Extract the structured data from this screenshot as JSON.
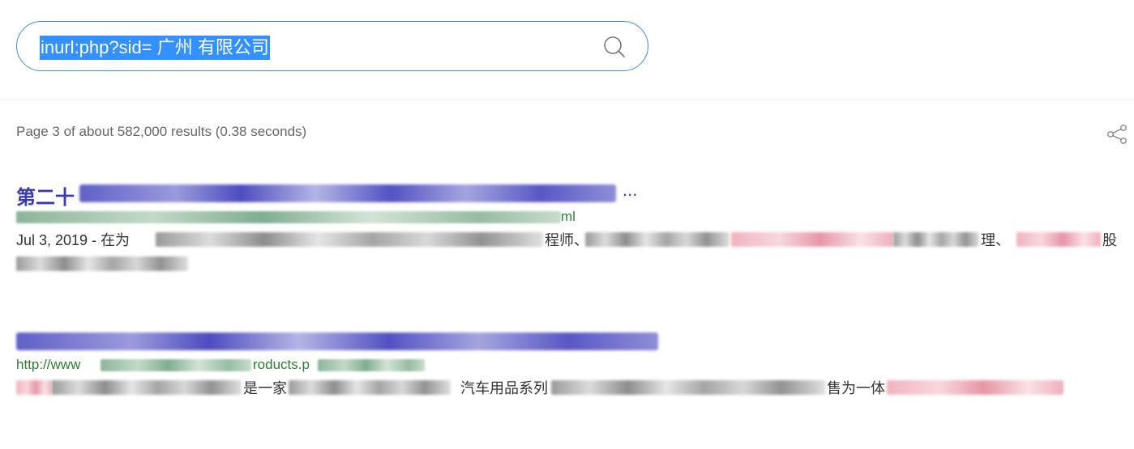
{
  "search": {
    "query": "inurl:php?sid= 广州 有限公司",
    "icon": "search-icon"
  },
  "stats": {
    "text": "Page 3 of about 582,000 results (0.38 seconds)"
  },
  "toolbar": {
    "share_icon": "share-icon"
  },
  "results": [
    {
      "title_lead": "第二十",
      "title_tail": "...",
      "url_tail": "ml",
      "snippet_date": "Jul 3, 2019 - 在为",
      "snippet_a": "程师、",
      "snippet_b": "理、",
      "snippet_c": "股"
    },
    {
      "url_lead": "http://www",
      "url_tail": "roducts.p",
      "snippet_a": "是一家",
      "snippet_b": "汽车用品系列",
      "snippet_c": "售为一体"
    }
  ],
  "colors": {
    "accent": "#3b8fe0",
    "title": "#3a3ab0",
    "url": "#2e7d32"
  }
}
